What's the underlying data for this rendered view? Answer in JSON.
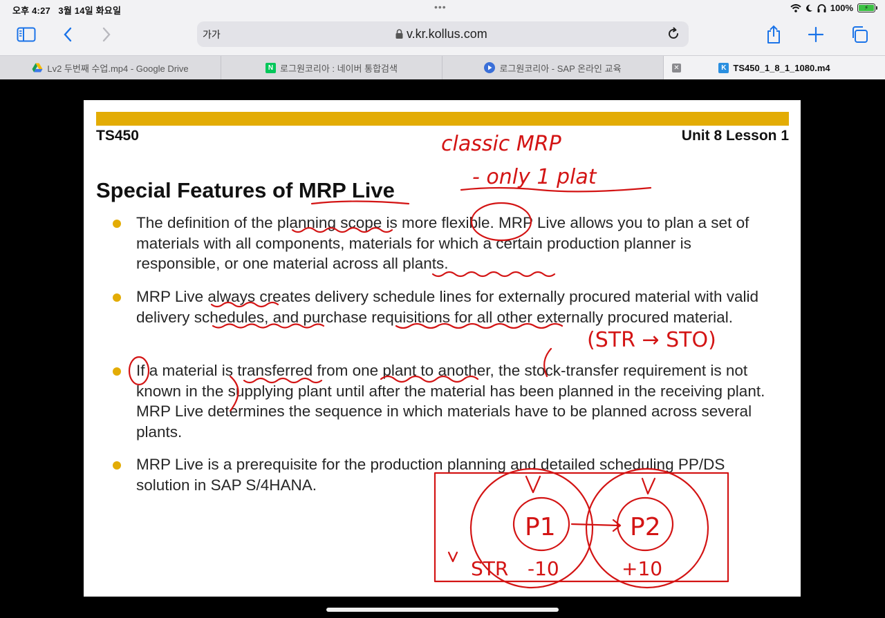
{
  "status": {
    "time": "오후 4:27",
    "date": "3월 14일 화요일",
    "battery": "100%"
  },
  "toolbar": {
    "text_size": "가가",
    "url": "v.kr.kollus.com"
  },
  "tabs": [
    {
      "label": "Lv2 두번째 수업.mp4 - Google Drive",
      "icon": "google-drive-icon"
    },
    {
      "label": "로그원코리아 : 네이버 통합검색",
      "icon": "naver-icon"
    },
    {
      "label": "로그원코리아 - SAP 온라인 교육",
      "icon": "play-icon"
    },
    {
      "label": "TS450_1_8_1_1080.m4",
      "icon": "kollus-icon"
    }
  ],
  "slide": {
    "course_code": "TS450",
    "unit": "Unit 8 Lesson 1",
    "title": "Special Features of MRP Live",
    "bullets": [
      "The definition of the planning scope is more flexible. MRP Live allows you to plan a set of materials with all components, materials for which a certain production planner is responsible, or one material across all plants.",
      "MRP Live always creates delivery schedule lines for externally procured material with valid delivery schedules, and purchase requisitions for all other externally procured material.",
      "If a material is transferred from one plant to another, the stock-transfer requirement is not known in the supplying plant until after the material has been planned in the receiving plant. MRP Live determines the sequence in which materials have to be planned across several plants.",
      "MRP Live is a prerequisite for the production planning and detailed scheduling PP/DS solution in SAP S/4HANA."
    ],
    "annotations": {
      "note1": "classic MRP",
      "note2": "- only 1 plat",
      "note3": "(STR → STO)",
      "p1": "P1",
      "p2": "P2",
      "str": "STR",
      "minus": "-10",
      "plus": "+10"
    }
  },
  "colors": {
    "accent": "#e3ac05",
    "ink": "#d31414",
    "ios_blue": "#1a73e8"
  }
}
